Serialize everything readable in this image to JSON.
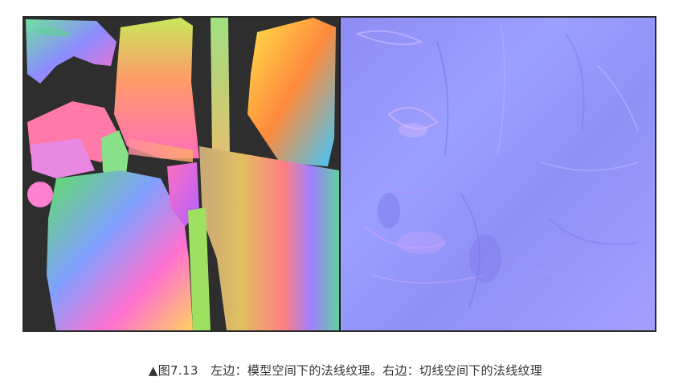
{
  "figure": {
    "left_panel": {
      "content": "object-space normal map texture"
    },
    "right_panel": {
      "content": "tangent-space normal map texture"
    },
    "colors": {
      "frame": "#2b2b2b",
      "left_background": "#2e2e2e",
      "right_base": "#9396f8"
    }
  },
  "caption": {
    "text": "▲图7.13　左边：模型空间下的法线纹理。右边：切线空间下的法线纹理"
  }
}
